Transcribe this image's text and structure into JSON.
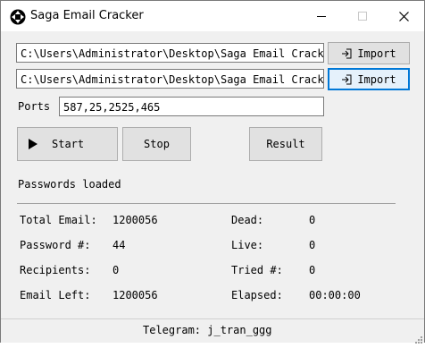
{
  "window": {
    "title": "Saga Email Cracker",
    "icons": {
      "app": "move-arrows-icon",
      "minimize": "minimize-icon",
      "maximize": "maximize-icon",
      "close": "close-icon"
    }
  },
  "inputs": {
    "path1": "C:\\Users\\Administrator\\Desktop\\Saga Email Cracker",
    "path2": "C:\\Users\\Administrator\\Desktop\\Saga Email Cracker",
    "ports_label": "Ports",
    "ports_value": "587,25,2525,465"
  },
  "buttons": {
    "import1": "Import",
    "import2": "Import",
    "start": "Start",
    "stop": "Stop",
    "result": "Result"
  },
  "status_message": "Passwords loaded",
  "stats": {
    "total_email_label": "Total Email:",
    "total_email_value": "1200056",
    "password_label": "Password #:",
    "password_value": "44",
    "recipients_label": "Recipients:",
    "recipients_value": "0",
    "email_left_label": "Email Left:",
    "email_left_value": "1200056",
    "dead_label": "Dead:",
    "dead_value": "0",
    "live_label": "Live:",
    "live_value": "0",
    "tried_label": "Tried #:",
    "tried_value": "0",
    "elapsed_label": "Elapsed:",
    "elapsed_value": "00:00:00"
  },
  "footer": {
    "telegram": "Telegram: j_tran_ggg"
  },
  "colors": {
    "focus_border": "#0078d7",
    "button_face": "#e1e1e1",
    "window_bg": "#f0f0f0"
  }
}
